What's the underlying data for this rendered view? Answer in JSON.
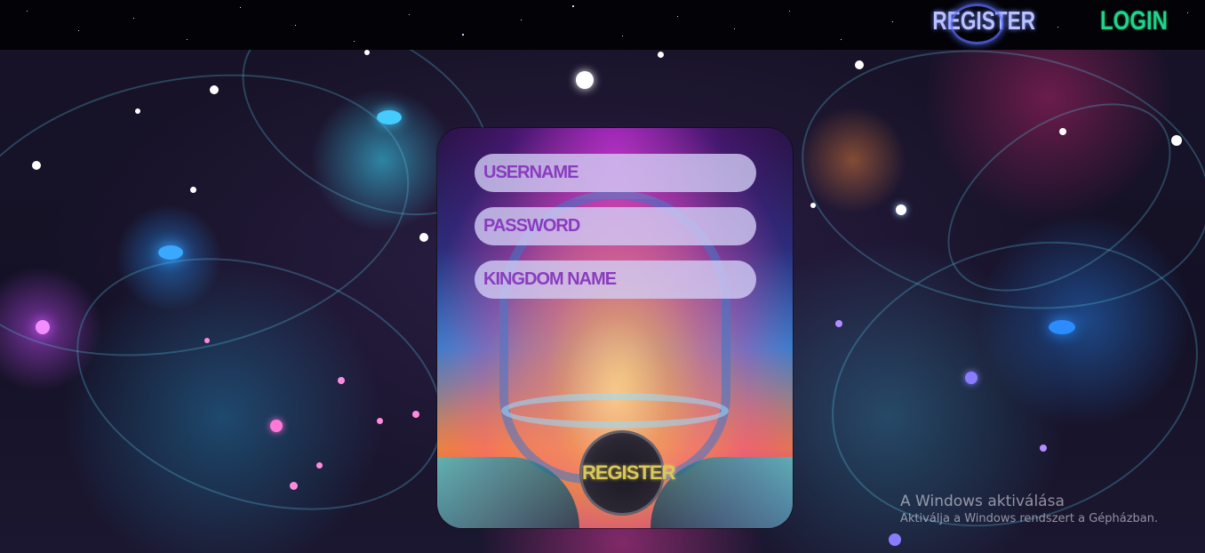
{
  "nav": {
    "register_label": "REGISTER",
    "login_label": "LOGIN"
  },
  "form": {
    "username_placeholder": "USERNAME",
    "password_placeholder": "PASSWORD",
    "kingdom_placeholder": "KINGDOM NAME",
    "submit_label": "REGISTER"
  },
  "watermark": {
    "title": "A Windows aktiválása",
    "subtitle": "Aktiválja a Windows rendszert a Gépházban."
  },
  "colors": {
    "nav_register": "#b9c2ff",
    "nav_login": "#1fd48a",
    "field_text": "#8a3cbf",
    "submit_text": "#d9c95a"
  }
}
